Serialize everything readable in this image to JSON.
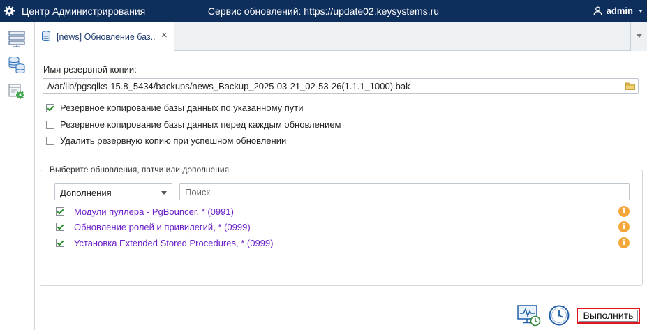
{
  "header": {
    "app_title": "Центр Администрирования",
    "service_title": "Сервис обновлений: https://update02.keysystems.ru",
    "user": "admin",
    "logo_icon": "gear-icon",
    "user_icon": "user-icon"
  },
  "sidebar": {
    "items": [
      {
        "icon": "servers-icon"
      },
      {
        "icon": "databases-icon"
      },
      {
        "icon": "settings-window-icon"
      }
    ]
  },
  "tabs": [
    {
      "label": "[news] Обновление баз...",
      "icon": "database-icon",
      "active": true
    }
  ],
  "form": {
    "backup_label": "Имя резервной копии:",
    "backup_path": "/var/lib/pgsqlks-15.8_5434/backups/news_Backup_2025-03-21_02-53-26(1.1.1_1000).bak",
    "options": [
      {
        "label": "Резервное копирование базы данных по указанному пути",
        "checked": true
      },
      {
        "label": "Резервное копирование базы данных перед каждым обновлением",
        "checked": false
      },
      {
        "label": "Удалить резервную копию при успешном обновлении",
        "checked": false
      }
    ]
  },
  "updates": {
    "legend": "Выберите обновления, патчи или дополнения",
    "filter_value": "Дополнения",
    "search_placeholder": "Поиск",
    "items": [
      {
        "label": "Модули пуллера - PgBouncer, * (0991)",
        "checked": true
      },
      {
        "label": "Обновление ролей и привилегий, * (0999)",
        "checked": true
      },
      {
        "label": "Установка Extended Stored Procedures, * (0999)",
        "checked": true
      }
    ]
  },
  "actions": {
    "run_label": "Выполнить"
  },
  "colors": {
    "header_bg": "#0e2e5c",
    "link_purple": "#6a1fc8",
    "info_orange": "#f3a73a",
    "highlight_red": "#e0141e"
  }
}
